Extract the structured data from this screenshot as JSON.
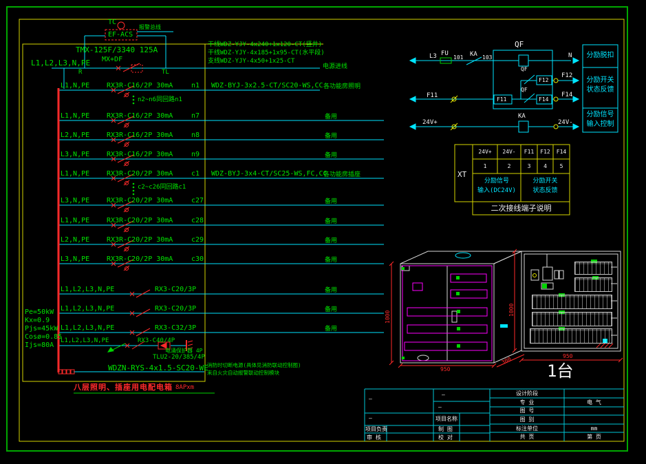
{
  "incoming": {
    "bus_label": "L1,L2,L3,N,PE",
    "tc": "TC",
    "ef_acs": "EF-ACS",
    "alarm_bus": "报警总线",
    "main_breaker": "TMX-125F/3340 125A",
    "trip": "MX+DF",
    "r": "R",
    "tl": "TL",
    "specs": [
      "干线WDZ-YJY-4x240+1x120-CT(竖井)",
      "干线WDZ-YJY-4x185+1x95-CT(水平段)",
      "支线WDZ-YJY-4x50+1x25-CT"
    ],
    "supply_label": "电源进线"
  },
  "params": {
    "pe": "Pe=50kW",
    "kx": "Kx=0.9",
    "pjs": "Pjs=45kW",
    "cos": "Cosø=0.85",
    "ijs": "Ijs=80A"
  },
  "feeders": [
    {
      "phases": "L1,N,PE",
      "spec": "RX3R-C16/2P 30mA",
      "id": "n1",
      "cable": "WDZ-BYJ-3x2.5-CT/SC20-WS,CC",
      "load": "各功能房照明"
    },
    {
      "phases": "L1,N,PE",
      "spec": "RX3R-C16/2P 30mA",
      "id": "n7",
      "load": "备用"
    },
    {
      "phases": "L2,N,PE",
      "spec": "RX3R-C16/2P 30mA",
      "id": "n8",
      "load": "备用"
    },
    {
      "phases": "L3,N,PE",
      "spec": "RX3R-C16/2P 30mA",
      "id": "n9",
      "load": "备用"
    },
    {
      "phases": "L1,N,PE",
      "spec": "RX3R-C20/2P 30mA",
      "id": "c1",
      "cable": "WDZ-BYJ-3x4-CT/SC25-WS,FC,CC",
      "load": "各功能房插座"
    },
    {
      "phases": "L3,N,PE",
      "spec": "RX3R-C20/2P 30mA",
      "id": "c27",
      "load": "备用"
    },
    {
      "phases": "L1,N,PE",
      "spec": "RX3R-C20/2P 30mA",
      "id": "c28",
      "load": "备用"
    },
    {
      "phases": "L2,N,PE",
      "spec": "RX3R-C20/2P 30mA",
      "id": "c29",
      "load": "备用"
    },
    {
      "phases": "L3,N,PE",
      "spec": "RX3R-C20/2P 30mA",
      "id": "c30",
      "load": "备用"
    },
    {
      "phases": "L1,L2,L3,N,PE",
      "spec": "RX3-C20/3P",
      "load": "备用"
    },
    {
      "phases": "L1,L2,L3,N,PE",
      "spec": "RX3-C20/3P",
      "load": "备用"
    },
    {
      "phases": "L1,L2,L3,N,PE",
      "spec": "RX3-C32/3P",
      "load": "备用"
    },
    {
      "phases": "L1,L2,L3,N,PE",
      "spec": "RX3-C40/4P"
    }
  ],
  "notes": {
    "group1": "n2~n6同回路n1",
    "group2": "c2~c26同回路c1"
  },
  "spd": {
    "name": "电涌保护器 4P",
    "model": "TLU2-20/385/4P"
  },
  "fire": {
    "cable": "WDZN-RYS-4x1.5-SC20-WE",
    "note1": "消防时切断电源(具体见消防联动控制图)",
    "note2": "来自火灾自动报警联动控制模块"
  },
  "title": {
    "name": "八层照明、插座用电配电箱",
    "tag": "8APxm"
  },
  "control": {
    "qf": "QF",
    "l3": "L3",
    "fu": "FU",
    "w101": "101",
    "ka": "KA",
    "w103": "103",
    "n": "N",
    "f11": "F11",
    "f12": "F12",
    "f14": "F14",
    "v24p": "24V+",
    "v24n": "24V-",
    "box1": "分励脱扣",
    "box2a": "分励开关",
    "box2b": "状态反馈",
    "box3a": "分励信号",
    "box3b": "输入控制"
  },
  "terminals": {
    "xt": "XT",
    "cols": [
      "24V+",
      "24V-",
      "F11",
      "F12",
      "F14"
    ],
    "nums": [
      "1",
      "2",
      "3",
      "4",
      "5"
    ],
    "in1": "分励信号",
    "in2": "输入(DC24V)",
    "fb1": "分励开关",
    "fb2": "状态反馈",
    "caption": "二次接线端子说明"
  },
  "cabinet": {
    "h": "1000",
    "w": "950",
    "d": "300",
    "h2": "1000",
    "w2": "950",
    "qty": "1台"
  },
  "titleblock": {
    "dash": "—",
    "proj_name": "项目名称",
    "proj_lead": "项目负责",
    "check": "审  核",
    "draw": "制  图",
    "proof": "校  对",
    "stage": "设计阶段",
    "major": "专  业",
    "major_v": "电  气",
    "fig_no": "图  号",
    "fig_type": "图  别",
    "unit": "标注单位",
    "unit_v": "mm",
    "pages": "共  页",
    "page_v": "第  页"
  }
}
